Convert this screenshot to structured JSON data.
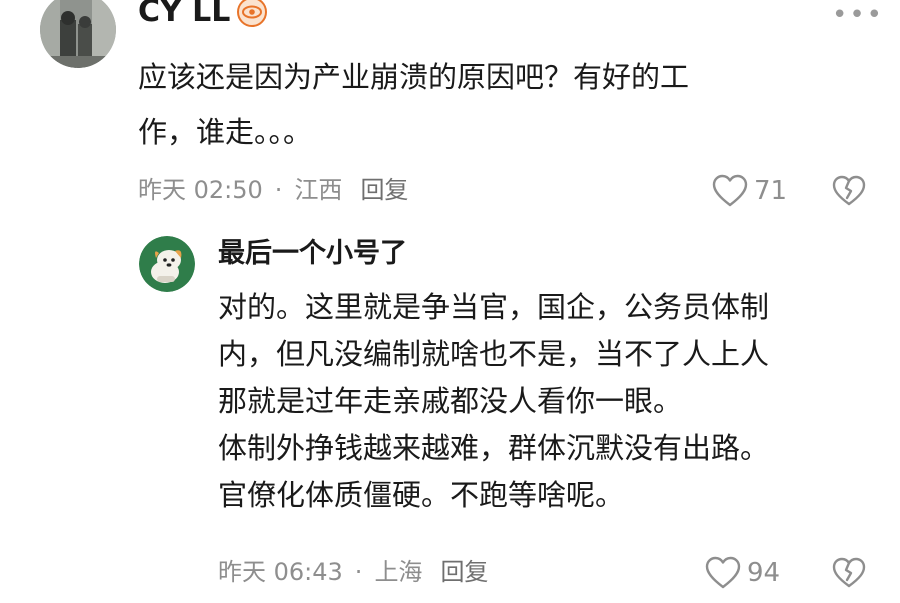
{
  "comments": [
    {
      "author": "CY LL",
      "text_lines": [
        "应该还是因为产业崩溃的原因吧？有好的工",
        "作，谁走。。。"
      ],
      "time": "昨天 02:50",
      "separator": "·",
      "location": "江西",
      "reply_label": "回复",
      "likes": "71",
      "avatar_icon": "photo-avatar-icon",
      "badge_icon": "eye-badge-icon",
      "more_icon": "more-dots-icon"
    },
    {
      "author": "最后一个小号了",
      "text_lines": [
        "对的。这里就是争当官，国企，公务员体制",
        "内，但凡没编制就啥也不是，当不了人上人",
        "那就是过年走亲戚都没人看你一眼。",
        "体制外挣钱越来越难，群体沉默没有出路。",
        "官僚化体质僵硬。不跑等啥呢。"
      ],
      "time": "昨天 06:43",
      "separator": "·",
      "location": "上海",
      "reply_label": "回复",
      "likes": "94",
      "avatar_icon": "cartoon-dog-avatar-icon"
    }
  ],
  "colors": {
    "meta_text": "#8e8e8e",
    "badge_orange": "#e8742a",
    "avatar_green": "#2f7d4a"
  }
}
